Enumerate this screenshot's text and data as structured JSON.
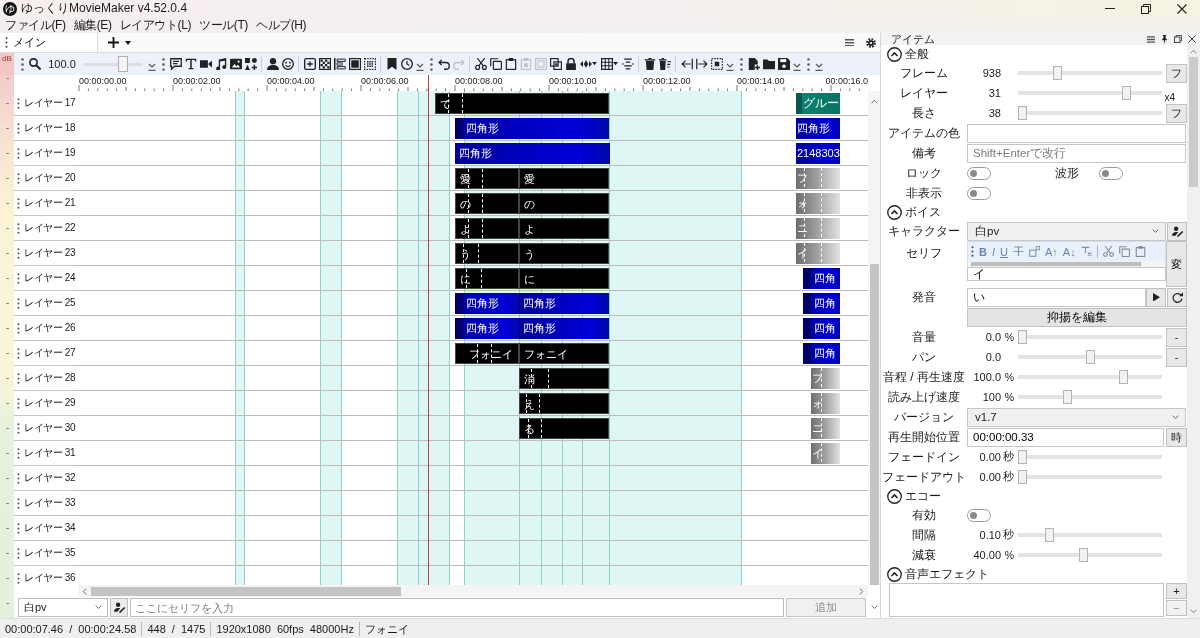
{
  "window": {
    "logo": "ゆ",
    "title": "ゆっくりMovieMaker v4.52.0.4"
  },
  "menu": [
    "ファイル(F)",
    "編集(E)",
    "レイアウト(L)",
    "ツール(T)",
    "ヘルプ(H)"
  ],
  "timeline": {
    "tabs": [
      {
        "label": "メイン",
        "selected": true
      }
    ],
    "meter_label": "dB",
    "zoom": {
      "value": "100.0",
      "level": 0.7
    },
    "history": [
      {
        "disabled": false
      },
      {
        "disabled": true
      }
    ],
    "clipboard": [
      {
        "disabled": false
      },
      {
        "disabled": false
      },
      {
        "disabled": false
      },
      {
        "disabled": true
      },
      {
        "disabled": true
      },
      {
        "disabled": false
      }
    ],
    "ruler": [
      "00:00:00.00",
      "00:00:02.00",
      "00:00:04.00",
      "00:00:06.00",
      "00:00:08.00",
      "00:00:10.00",
      "00:00:12.00",
      "00:00:14.00",
      "00:00:16.0"
    ],
    "layers": [
      {
        "name": "レイヤー 17",
        "clips": [
          {
            "kind": "voice",
            "label": "て"
          },
          {
            "kind": "group",
            "label": "グルー"
          }
        ]
      },
      {
        "name": "レイヤー 18",
        "clips": [
          {
            "kind": "shape",
            "label": "四角形"
          },
          {
            "kind": "shape",
            "label": "四角形"
          }
        ]
      },
      {
        "name": "レイヤー 19",
        "clips": [
          {
            "kind": "shape",
            "label": "四角形"
          },
          {
            "kind": "shape",
            "label": "2148303"
          }
        ]
      },
      {
        "name": "レイヤー 20",
        "clips": [
          {
            "kind": "voice",
            "label": "愛"
          },
          {
            "kind": "voice",
            "label": "愛"
          },
          {
            "kind": "ghost",
            "label": "フ"
          }
        ]
      },
      {
        "name": "レイヤー 21",
        "clips": [
          {
            "kind": "voice",
            "label": "の"
          },
          {
            "kind": "voice",
            "label": "の"
          },
          {
            "kind": "ghost",
            "label": "ォ"
          }
        ]
      },
      {
        "name": "レイヤー 22",
        "clips": [
          {
            "kind": "voice",
            "label": "よ"
          },
          {
            "kind": "voice",
            "label": "よ"
          },
          {
            "kind": "ghost",
            "label": "ニ"
          }
        ]
      },
      {
        "name": "レイヤー 23",
        "clips": [
          {
            "kind": "voice",
            "label": "う"
          },
          {
            "kind": "voice",
            "label": "う"
          },
          {
            "kind": "ghost",
            "label": "イ"
          }
        ]
      },
      {
        "name": "レイヤー 24",
        "clips": [
          {
            "kind": "voice",
            "label": "に"
          },
          {
            "kind": "voice",
            "label": "に"
          },
          {
            "kind": "shape",
            "label": "四角"
          }
        ]
      },
      {
        "name": "レイヤー 25",
        "clips": [
          {
            "kind": "shape",
            "label": "四角形"
          },
          {
            "kind": "shape",
            "label": "四角形"
          },
          {
            "kind": "shape",
            "label": "四角"
          }
        ]
      },
      {
        "name": "レイヤー 26",
        "clips": [
          {
            "kind": "shape",
            "label": "四角形"
          },
          {
            "kind": "shape",
            "label": "四角形"
          },
          {
            "kind": "shape",
            "label": "四角"
          }
        ]
      },
      {
        "name": "レイヤー 27",
        "clips": [
          {
            "kind": "voice",
            "label": "フォニイ"
          },
          {
            "kind": "voice",
            "label": "フォニイ"
          },
          {
            "kind": "shape",
            "label": "四角"
          }
        ]
      },
      {
        "name": "レイヤー 28",
        "clips": [
          {
            "kind": "voice",
            "label": "消"
          },
          {
            "kind": "ghost",
            "label": "フ"
          }
        ]
      },
      {
        "name": "レイヤー 29",
        "clips": [
          {
            "kind": "voice",
            "label": "え"
          },
          {
            "kind": "ghost",
            "label": "ォ"
          }
        ]
      },
      {
        "name": "レイヤー 30",
        "clips": [
          {
            "kind": "voice",
            "label": "る"
          },
          {
            "kind": "ghost",
            "label": "ニ"
          }
        ]
      },
      {
        "name": "レイヤー 31",
        "clips": [
          {
            "kind": "ghost",
            "label": "イ"
          }
        ]
      },
      {
        "name": "レイヤー 32"
      },
      {
        "name": "レイヤー 33"
      },
      {
        "name": "レイヤー 34"
      },
      {
        "name": "レイヤー 35"
      },
      {
        "name": "レイヤー 36"
      }
    ],
    "speech_bar": {
      "character": "白pv",
      "placeholder": "ここにセリフを入力",
      "add_button": {
        "label": "追加",
        "disabled": true
      }
    }
  },
  "item_panel": {
    "title": "アイテム",
    "sections": [
      {
        "title": "全般",
        "expanded": true,
        "rows": [
          {
            "kind": "slider",
            "label": "フレーム",
            "value": "938",
            "level": 0.26,
            "button": "フ"
          },
          {
            "kind": "slider",
            "label": "レイヤー",
            "value": "31",
            "level": 0.77,
            "note": "x4"
          },
          {
            "kind": "slider",
            "label": "長さ",
            "value": "38",
            "level": 0.0,
            "button": "フ"
          },
          {
            "kind": "field",
            "label": "アイテムの色"
          },
          {
            "kind": "field",
            "label": "備考",
            "placeholder": "Shift+Enterで改行"
          },
          {
            "kind": "toggles",
            "items": [
              {
                "label": "ロック",
                "on": false
              },
              {
                "label": "波形",
                "on": false
              }
            ]
          },
          {
            "kind": "toggle",
            "label": "非表示",
            "on": false
          }
        ]
      },
      {
        "title": "ボイス",
        "expanded": true,
        "rows": [
          {
            "kind": "dropdown",
            "label": "キャラクター",
            "value": "白pv",
            "icon_button": true
          },
          {
            "kind": "serif",
            "label": "セリフ",
            "format_buttons": [
              "B",
              "I",
              "U"
            ],
            "size_buttons": [
              "A↑",
              "A↓"
            ],
            "value": "イ",
            "button": "変"
          },
          {
            "kind": "pronunciation",
            "label": "発音",
            "value": "い"
          },
          {
            "kind": "wide_button",
            "label": "抑揚を編集"
          },
          {
            "kind": "slider",
            "label": "音量",
            "value": "0.0",
            "unit": "%",
            "level": 0.0,
            "button": "-"
          },
          {
            "kind": "slider",
            "label": "パン",
            "value": "0.0",
            "level": 0.5,
            "button": "-"
          },
          {
            "kind": "slider",
            "label": "音程 / 再生速度",
            "value": "100.0",
            "unit": "%",
            "level": 0.75
          },
          {
            "kind": "slider",
            "label": "読み上げ速度",
            "value": "100",
            "unit": "%",
            "level": 0.33
          },
          {
            "kind": "dropdown",
            "label": "バージョン",
            "value": "v1.7"
          },
          {
            "kind": "field",
            "label": "再生開始位置",
            "value": "00:00:00.33",
            "button": "時"
          },
          {
            "kind": "slider",
            "label": "フェードイン",
            "value": "0.00",
            "unit": "秒",
            "level": 0.0
          },
          {
            "kind": "slider",
            "label": "フェードアウト",
            "value": "0.00",
            "unit": "秒",
            "level": 0.0
          }
        ]
      },
      {
        "title": "エコー",
        "expanded": true,
        "rows": [
          {
            "kind": "toggle",
            "label": "有効",
            "on": false
          },
          {
            "kind": "slider",
            "label": "間隔",
            "value": "0.10",
            "unit": "秒",
            "level": 0.2
          },
          {
            "kind": "slider",
            "label": "減衰",
            "value": "40.00",
            "unit": "%",
            "level": 0.45
          }
        ]
      },
      {
        "title": "音声エフェクト",
        "expanded": true,
        "rows": [
          {
            "kind": "list",
            "buttons": [
              {
                "label": "+",
                "disabled": false
              },
              {
                "label": "−",
                "disabled": true
              }
            ]
          }
        ]
      }
    ]
  },
  "status_bar": [
    "00:00:07.46 / 00:00:24.58",
    "448 / 1475",
    "1920x1080 60fps 48000Hz",
    "フォニイ"
  ]
}
